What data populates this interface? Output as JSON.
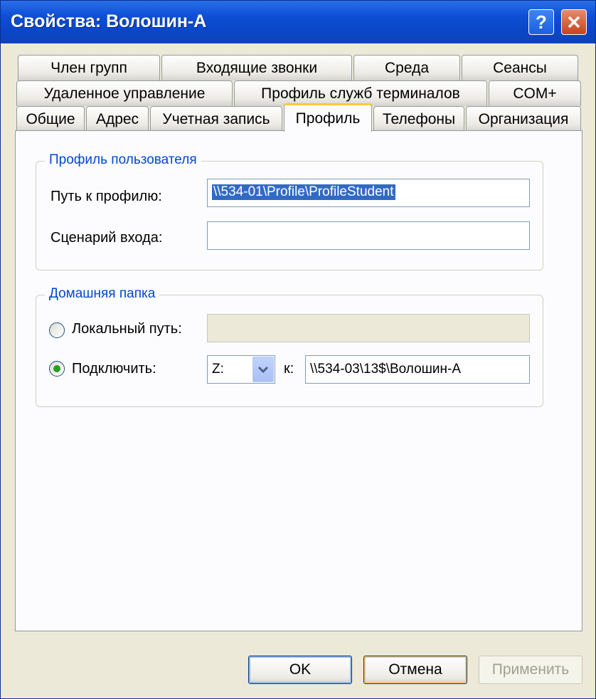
{
  "window": {
    "title": "Свойства: Волошин-А"
  },
  "title_buttons": {
    "help": "?",
    "close": "close"
  },
  "tabs": {
    "row1": [
      "Член групп",
      "Входящие звонки",
      "Среда",
      "Сеансы"
    ],
    "row2": [
      "Удаленное управление",
      "Профиль служб терминалов",
      "COM+"
    ],
    "row3": [
      "Общие",
      "Адрес",
      "Учетная запись",
      "Профиль",
      "Телефоны",
      "Организация"
    ],
    "active": "Профиль"
  },
  "profile_group": {
    "title": "Профиль пользователя",
    "profile_path_label": "Путь к профилю:",
    "profile_path_value": "\\\\534-01\\Profile\\ProfileStudent",
    "logon_script_label": "Сценарий входа:",
    "logon_script_value": ""
  },
  "home_group": {
    "title": "Домашняя папка",
    "local_path_label": "Локальный путь:",
    "local_path_value": "",
    "connect_label": "Подключить:",
    "drive_value": "Z:",
    "to_label": "к:",
    "connect_path_value": "\\\\534-03\\13$\\Волошин-А",
    "selected": "connect"
  },
  "buttons": {
    "ok": "OK",
    "cancel": "Отмена",
    "apply": "Применить"
  }
}
